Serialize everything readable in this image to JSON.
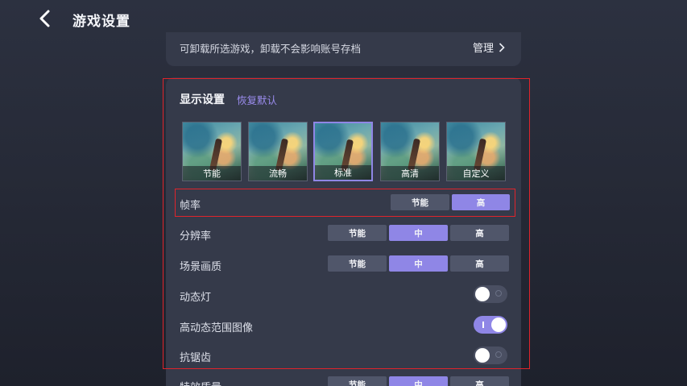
{
  "header": {
    "title": "游戏设置"
  },
  "manage": {
    "description": "可卸载所选游戏，卸载不会影响账号存档",
    "link_label": "管理"
  },
  "display": {
    "title": "显示设置",
    "reset_label": "恢复默认",
    "presets": [
      {
        "label": "节能",
        "selected": false
      },
      {
        "label": "流畅",
        "selected": false
      },
      {
        "label": "标准",
        "selected": true
      },
      {
        "label": "高清",
        "selected": false
      },
      {
        "label": "自定义",
        "selected": false
      }
    ]
  },
  "settings": {
    "frame_rate": {
      "label": "帧率",
      "options": [
        "节能",
        "高"
      ],
      "selected": "高"
    },
    "resolution": {
      "label": "分辨率",
      "options": [
        "节能",
        "中",
        "高"
      ],
      "selected": "中"
    },
    "scene_quality": {
      "label": "场景画质",
      "options": [
        "节能",
        "中",
        "高"
      ],
      "selected": "中"
    },
    "dynamic_light": {
      "label": "动态灯",
      "state": "off"
    },
    "hdr": {
      "label": "高动态范围图像",
      "state": "on"
    },
    "anti_aliasing": {
      "label": "抗锯齿",
      "state": "off"
    },
    "effects_quality": {
      "label": "特效质量",
      "options": [
        "节能",
        "中",
        "高"
      ],
      "selected": "中"
    }
  },
  "colors": {
    "accent": "#8f86e6",
    "card": "#353a4a",
    "highlight_border": "#e0242b"
  }
}
